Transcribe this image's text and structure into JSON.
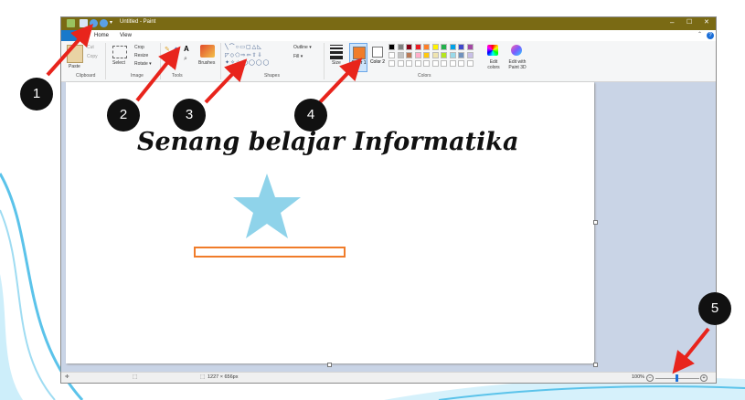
{
  "window": {
    "title": "Untitled - Paint",
    "minimize": "–",
    "maximize": "☐",
    "close": "✕"
  },
  "menu": {
    "file": "",
    "home": "Home",
    "view": "View",
    "help": "?"
  },
  "ribbon": {
    "clipboard": {
      "paste": "Paste",
      "cut": "Cut",
      "copy": "Copy",
      "group": "Clipboard"
    },
    "image": {
      "select": "Select",
      "crop": "Crop",
      "resize": "Resize",
      "rotate": "Rotate ▾",
      "group": "Image"
    },
    "tools": {
      "group": "Tools",
      "text": "A"
    },
    "brushes": {
      "label": "Brushes"
    },
    "shapes": {
      "outline": "Outline ▾",
      "fill": "Fill ▾",
      "group": "Shapes"
    },
    "size": {
      "label": "Size"
    },
    "color1": {
      "label": "Color 1",
      "value": "#f07c2a"
    },
    "color2": {
      "label": "Color 2",
      "value": "#ffffff"
    },
    "edit_colors": "Edit colors",
    "edit_paint3d": "Edit with Paint 3D",
    "colors_group": "Colors",
    "palette_row1": [
      "#000000",
      "#7f7f7f",
      "#880015",
      "#ed1c24",
      "#ff7f27",
      "#fff200",
      "#22b14c",
      "#00a2e8",
      "#3f48cc",
      "#a349a4"
    ],
    "palette_row2": [
      "#ffffff",
      "#c3c3c3",
      "#b97a57",
      "#ffaec9",
      "#ffc90e",
      "#efe4b0",
      "#b5e61d",
      "#99d9ea",
      "#7092be",
      "#c8bfe7"
    ]
  },
  "canvas": {
    "headline": "Senang belajar Informatika",
    "star_color": "#8fd3ea",
    "rect_color": "#f07c2a"
  },
  "status": {
    "dimensions": "1227 × 656px",
    "zoom": "100%",
    "zoom_out": "−",
    "zoom_in": "+"
  },
  "callouts": [
    "1",
    "2",
    "3",
    "4",
    "5"
  ],
  "colors": {
    "titlebar": "#7a6a14",
    "arrow": "#e8241c",
    "marker": "#111111"
  }
}
